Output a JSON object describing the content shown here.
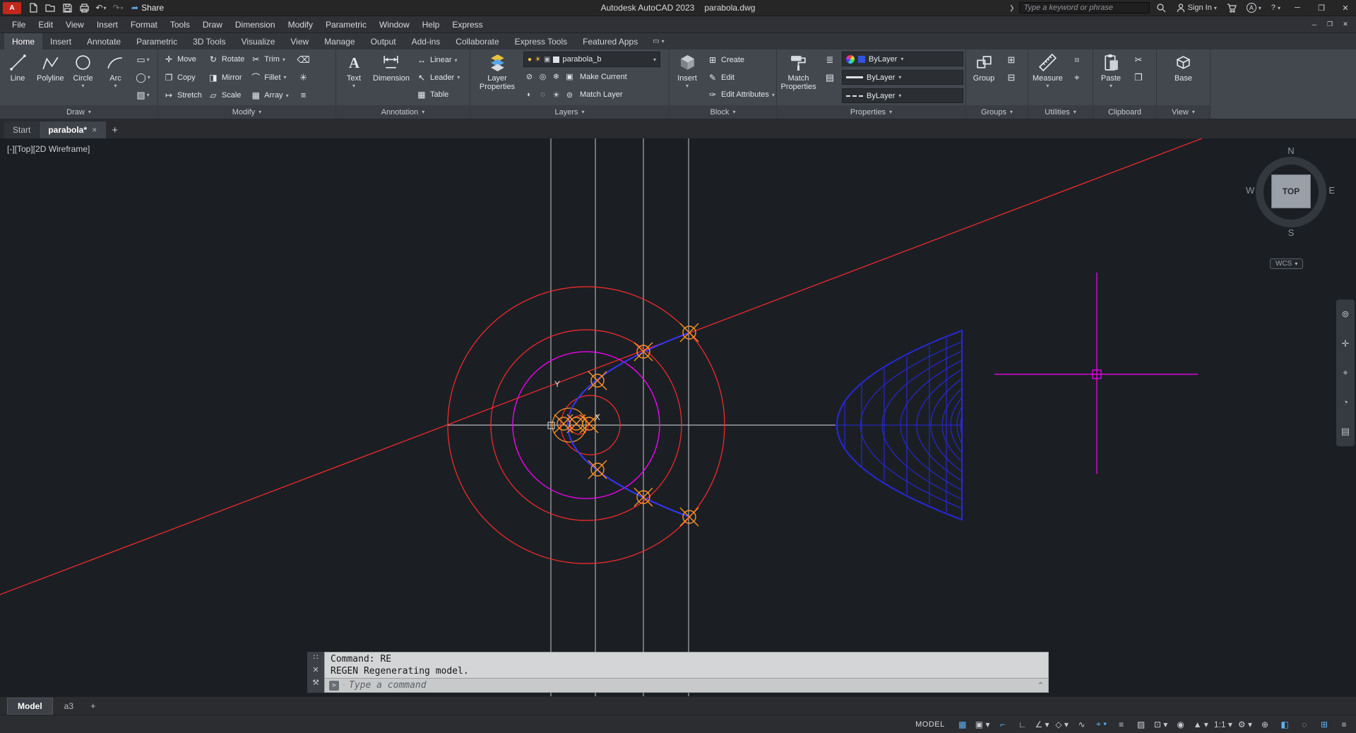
{
  "ui": {
    "caret_down": "▾",
    "caret_up": "⌃",
    "chevron_right": "❯",
    "close_glyph": "✕",
    "minimize_glyph": "─",
    "restore_glyph": "❐",
    "plus_glyph": "+"
  },
  "titlebar": {
    "logo_text": "A",
    "share_glyph": "➦",
    "share_label": "Share",
    "app_name": "Autodesk AutoCAD 2023",
    "doc_name": "parabola.dwg",
    "search_placeholder": "Type a keyword or phrase",
    "signin_label": "Sign In",
    "undo_glyph": "↶",
    "redo_glyph": "↷",
    "apps_badge": "A",
    "help_glyph": "?"
  },
  "menubar": {
    "items": [
      "File",
      "Edit",
      "View",
      "Insert",
      "Format",
      "Tools",
      "Draw",
      "Dimension",
      "Modify",
      "Parametric",
      "Window",
      "Help",
      "Express"
    ]
  },
  "ribbon": {
    "tabs": [
      "Home",
      "Insert",
      "Annotate",
      "Parametric",
      "3D Tools",
      "Visualize",
      "View",
      "Manage",
      "Output",
      "Add-ins",
      "Collaborate",
      "Express Tools",
      "Featured Apps"
    ],
    "display_glyph": "▭",
    "draw": {
      "label": "Draw",
      "line": "Line",
      "polyline": "Polyline",
      "circle": "Circle",
      "arc": "Arc",
      "rect_glyph": "▭",
      "ellipse_glyph": "◯",
      "hatch_glyph": "▨"
    },
    "modify": {
      "label": "Modify",
      "items": [
        {
          "label": "Move",
          "glyph": "✛"
        },
        {
          "label": "Rotate",
          "glyph": "↻"
        },
        {
          "label": "Trim",
          "glyph": "✂"
        },
        {
          "label": "Copy",
          "glyph": "❐"
        },
        {
          "label": "Mirror",
          "glyph": "◨"
        },
        {
          "label": "Fillet",
          "glyph": "⌒"
        },
        {
          "label": "Stretch",
          "glyph": "↦"
        },
        {
          "label": "Scale",
          "glyph": "▱"
        },
        {
          "label": "Array",
          "glyph": "▦"
        }
      ],
      "extra_glyphs": [
        "⌫",
        "✳",
        "≡"
      ]
    },
    "annotation": {
      "label": "Annotation",
      "text_label": "Text",
      "text_icon": "A",
      "dimension_label": "Dimension",
      "items": [
        {
          "label": "Linear",
          "glyph": "↔"
        },
        {
          "label": "Leader",
          "glyph": "↖"
        },
        {
          "label": "Table",
          "glyph": "▦"
        }
      ]
    },
    "layers": {
      "label": "Layers",
      "big": "Layer Properties",
      "layer_name": "parabola_b",
      "bulb_glyph": "●",
      "sun_glyph": "☀",
      "lock_glyph": "▣",
      "row1_glyphs": [
        "⊘",
        "◎",
        "❄",
        "▣"
      ],
      "row1_label": "Make Current",
      "row2_glyphs": [
        "◐",
        "◌",
        "☀",
        "⊜"
      ],
      "row2_label": "Match Layer"
    },
    "block": {
      "label": "Block",
      "big": "Insert",
      "items": [
        {
          "label": "Create",
          "glyph": "⊞"
        },
        {
          "label": "Edit",
          "glyph": "✎"
        },
        {
          "label": "Edit Attributes",
          "glyph": "✑"
        }
      ]
    },
    "properties": {
      "label": "Properties",
      "big": "Match Properties",
      "side_glyphs": [
        "≣",
        "▤"
      ],
      "values": [
        "ByLayer",
        "ByLayer",
        "ByLayer"
      ]
    },
    "groups": {
      "label": "Groups",
      "big": "Group",
      "side_glyphs": [
        "⊞",
        "⊟"
      ]
    },
    "utilities": {
      "label": "Utilities",
      "big": "Measure",
      "side_glyphs": [
        "⌗",
        "⌖"
      ]
    },
    "clipboard": {
      "label": "Clipboard",
      "big": "Paste",
      "side_glyphs": [
        "✂",
        "❐"
      ]
    },
    "view": {
      "label": "View",
      "big": "Base"
    }
  },
  "file_tabs": {
    "start": "Start",
    "doc": "parabola*"
  },
  "viewport": {
    "corner_label": "[-][Top][2D Wireframe]",
    "axis_x": "X",
    "axis_y": "Y",
    "viewcube": {
      "n": "N",
      "w": "W",
      "e": "E",
      "s": "S",
      "top": "TOP",
      "wcs": "WCS"
    },
    "navbar_glyphs": [
      "⊚",
      "✛",
      "⌖",
      "◔",
      "▤"
    ]
  },
  "command": {
    "history": [
      "Command: RE",
      "REGEN Regenerating model."
    ],
    "placeholder": "Type a command",
    "grip_glyph": "∷",
    "tools_glyph": "⚒",
    "prompt_glyph": ">"
  },
  "layout_tabs": {
    "model": "Model",
    "layout1": "a3"
  },
  "statusbar": {
    "model_label": "MODEL",
    "icons": [
      {
        "name": "grid",
        "glyph": "▦",
        "active": true
      },
      {
        "name": "snap-mode",
        "glyph": "▣ ▾",
        "active": false
      },
      {
        "name": "dynamic-input",
        "glyph": "⌐",
        "active": true
      },
      {
        "name": "ortho-mode",
        "glyph": "∟",
        "active": false
      },
      {
        "name": "polar-tracking",
        "glyph": "∠ ▾",
        "active": false
      },
      {
        "name": "isometric-drafting",
        "glyph": "◇ ▾",
        "active": false
      },
      {
        "name": "object-snap-tracking",
        "glyph": "∿",
        "active": false
      },
      {
        "name": "object-snap",
        "glyph": "⌖ ▾",
        "active": true
      },
      {
        "name": "lineweight",
        "glyph": "≡",
        "active": false
      },
      {
        "name": "transparency",
        "glyph": "▨",
        "active": false
      },
      {
        "name": "selection-cycling",
        "glyph": "⊡ ▾",
        "active": false
      },
      {
        "name": "annotation-visibility",
        "glyph": "◉",
        "active": false
      },
      {
        "name": "autoscale",
        "glyph": "▲ ▾",
        "active": false
      },
      {
        "name": "annotation-scale",
        "glyph": "1:1 ▾",
        "active": false
      },
      {
        "name": "workspace-switching",
        "glyph": "⚙ ▾",
        "active": false
      },
      {
        "name": "annotation-monitor",
        "glyph": "⊕",
        "active": false
      },
      {
        "name": "graphics-performance",
        "glyph": "◧",
        "active": true
      },
      {
        "name": "isolate-objects",
        "glyph": "◌",
        "active": false
      },
      {
        "name": "clean-screen",
        "glyph": "⊞",
        "active": true
      },
      {
        "name": "customization",
        "glyph": "≡",
        "active": false
      }
    ]
  },
  "colors": {
    "red": "#ff2a2a",
    "magenta": "#ff00ff",
    "blue": "#3636ff",
    "mesh_blue": "#2828dd",
    "orange": "#ff9224",
    "line_white": "#d9dcdf",
    "accent_blue": "#5cb3f5"
  }
}
